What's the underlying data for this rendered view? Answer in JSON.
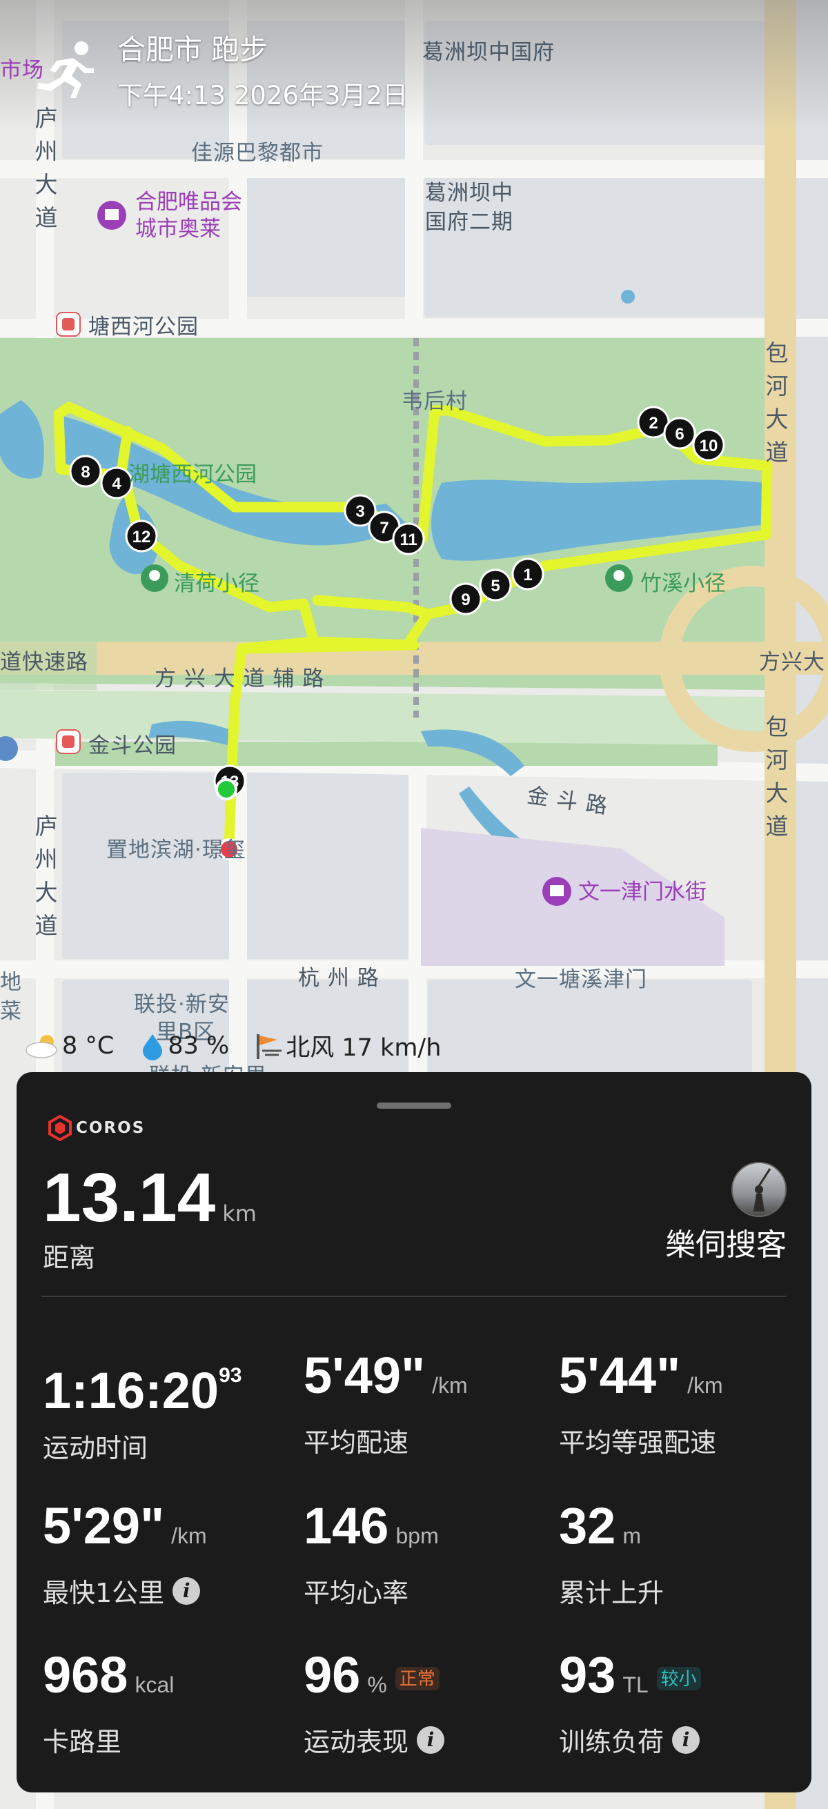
{
  "header": {
    "title": "合肥市 跑步",
    "datetime": "下午4:13 2026年3月2日",
    "activity_icon": "runner-icon"
  },
  "map": {
    "labels": {
      "city_mall": "市场",
      "gezhouba": "葛洲坝中国府",
      "gezhouba2_line1": "葛洲坝中",
      "gezhouba2_line2": "国府二期",
      "jiayuan": "佳源巴黎都市",
      "vip_line1": "合肥唯品会",
      "vip_line2": "城市奥莱",
      "tangxihe": "塘西河公园",
      "weihoucun": "韦后村",
      "park_lake": "湖塘西河公园",
      "qinghe": "清荷小径",
      "zhuxi": "竹溪小径",
      "expressway": "道快速路",
      "fangxing_aux": "方 兴 大 道 辅 路",
      "fangxing_right": "方兴大",
      "jindou_park": "金斗公园",
      "jindou_road": "金 斗 路",
      "zhidi": "置地滨湖·璟玺",
      "wenyi_jinmen": "文一津门水街",
      "hangzhou_road": "杭 州 路",
      "wenyi_tangxi": "文一塘溪津门",
      "liantou_line1": "联投·新安",
      "liantou_line2": "里B区",
      "liantou_line3": "联投·新安里",
      "left_di": "地",
      "left_cai": "菜",
      "luzhou_top": "庐州大道",
      "luzhou_bottom": "庐州大道",
      "baohe_top": "包河大道",
      "baohe_bottom": "包河大道"
    },
    "km_markers": [
      "1",
      "2",
      "3",
      "4",
      "5",
      "6",
      "7",
      "8",
      "9",
      "10",
      "11",
      "12",
      "13"
    ]
  },
  "weather": {
    "temp": "8 °C",
    "humidity": "83 %",
    "wind": "北风 17 km/h"
  },
  "panel": {
    "brand": "COROS",
    "distance_value": "13.14",
    "distance_unit": "km",
    "distance_label": "距离",
    "username": "樂伺搜客",
    "stats": [
      {
        "value": "1:16:20",
        "sup": "93",
        "unit": "",
        "label": "运动时间"
      },
      {
        "value": "5'49\"",
        "unit": "/km",
        "label": "平均配速"
      },
      {
        "value": "5'44\"",
        "unit": "/km",
        "label": "平均等强配速"
      },
      {
        "value": "5'29\"",
        "unit": "/km",
        "label": "最快1公里"
      },
      {
        "value": "146",
        "unit": "bpm",
        "label": "平均心率"
      },
      {
        "value": "32",
        "unit": "m",
        "label": "累计上升"
      },
      {
        "value": "968",
        "unit": "kcal",
        "label": "卡路里"
      },
      {
        "value": "96",
        "unit": "%",
        "label": "运动表现",
        "badge": "正常"
      },
      {
        "value": "93",
        "unit": "TL",
        "label": "训练负荷",
        "badge": "较小"
      }
    ],
    "colors": {
      "badge_normal": "#e8743b",
      "badge_low": "#2fc0c0",
      "track": "#e3f52c"
    }
  }
}
